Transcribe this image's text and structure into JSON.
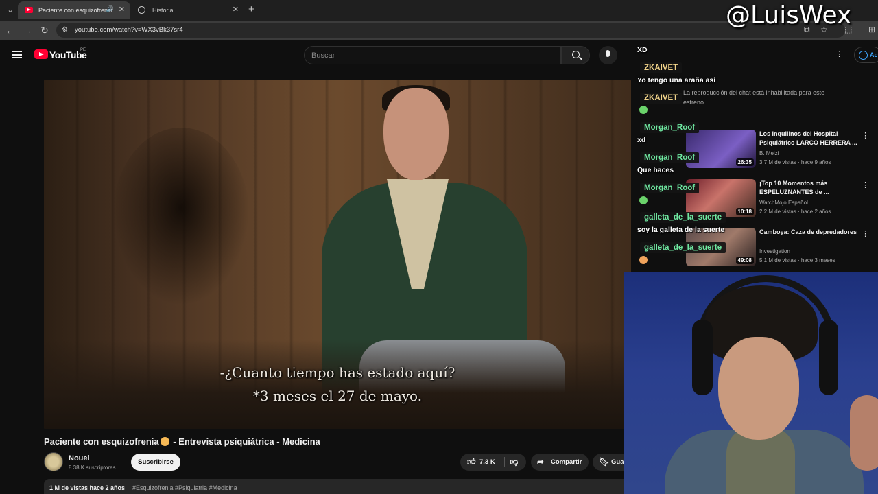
{
  "browser": {
    "tabs": [
      {
        "label": "Paciente con esquizofrenia",
        "active": true
      },
      {
        "label": "Historial",
        "active": false
      }
    ],
    "url": "youtube.com/watch?v=WX3vBk37sr4"
  },
  "youtube": {
    "logo_text": "YouTube",
    "country_code": "PE",
    "search_placeholder": "Buscar",
    "video": {
      "subtitle_line1": "-¿Cuanto tiempo has estado aquí?",
      "subtitle_line2": "*3 meses el 27 de mayo.",
      "title_part1": "Paciente con esquizofrenia",
      "title_part2": " - Entrevista psiquiátrica - Medicina",
      "channel": "Nouel",
      "subscribers": "8.38 K suscriptores",
      "subscribe_label": "Suscribirse",
      "likes": "7.3 K",
      "share_label": "Compartir",
      "save_label": "Gua",
      "views": "1 M de vistas  hace 2 años",
      "hashtags": "#Esquizofrenia #Psiquiatria #Medicina"
    },
    "signin_label": "Ac",
    "chat_disabled": "La reproducción del chat está inhabilitada para este estreno.",
    "recommendations": [
      {
        "title": "Los Inquilinos del Hospital Psiquiátrico LARCO HERRERA ...",
        "channel": "B. Meizi",
        "meta": "3.7 M de vistas · hace 9 años",
        "duration": "26:35"
      },
      {
        "title": "¡Top 10 Momentos más ESPELUZNANTES de ...",
        "channel": "WatchMojo Español",
        "meta": "2.2 M de vistas · hace 2 años",
        "duration": "10:18"
      },
      {
        "title": "Camboya: Caza de depredadores",
        "channel": "Investigation",
        "meta": "5.1 M de vistas · hace 3 meses",
        "duration": "49:08"
      }
    ]
  },
  "stream_chat": [
    {
      "user": "",
      "message": "XD"
    },
    {
      "user": "ZKAIVET",
      "message": "Yo tengo una araña asi"
    },
    {
      "user": "ZKAIVET",
      "message": ""
    },
    {
      "user": "Morgan_Roof",
      "message": "xd"
    },
    {
      "user": "Morgan_Roof",
      "message": "Que haces"
    },
    {
      "user": "Morgan_Roof",
      "message": ""
    },
    {
      "user": "galleta_de_la_suerte",
      "message": "soy la galleta de la suerte"
    },
    {
      "user": "galleta_de_la_suerte",
      "message": ""
    }
  ],
  "watermark": "@LuisWex",
  "colors": {
    "youtube_red": "#ff0033",
    "chat_gold": "#f2d48a",
    "chat_green": "#6ee7a0",
    "link_blue": "#3ea6ff"
  }
}
